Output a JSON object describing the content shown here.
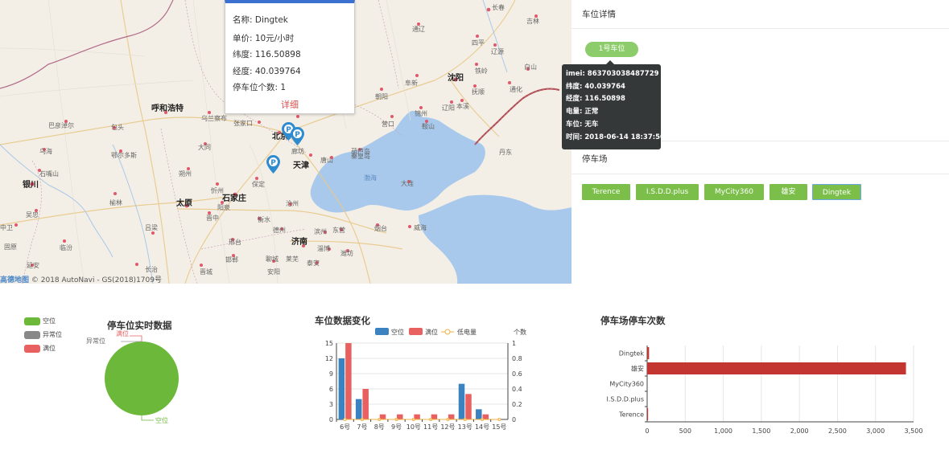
{
  "map": {
    "cities": [
      {
        "name": "长春",
        "big": false
      },
      {
        "name": "吉林",
        "big": false
      },
      {
        "name": "通辽",
        "big": false
      },
      {
        "name": "四平",
        "big": false
      },
      {
        "name": "辽源",
        "big": false
      },
      {
        "name": "铁岭",
        "big": false
      },
      {
        "name": "沈阳",
        "big": true
      },
      {
        "name": "白山",
        "big": false
      },
      {
        "name": "通化",
        "big": false
      },
      {
        "name": "抚顺",
        "big": false
      },
      {
        "name": "本溪",
        "big": false
      },
      {
        "name": "辽阳",
        "big": false
      },
      {
        "name": "阜新",
        "big": false
      },
      {
        "name": "朝阳",
        "big": false
      },
      {
        "name": "锦州",
        "big": false
      },
      {
        "name": "鞍山",
        "big": false
      },
      {
        "name": "营口",
        "big": false
      },
      {
        "name": "丹东",
        "big": false
      },
      {
        "name": "葫芦岛",
        "big": false
      },
      {
        "name": "秦皇岛",
        "big": false
      },
      {
        "name": "承德",
        "big": false
      },
      {
        "name": "呼和浩特",
        "big": true
      },
      {
        "name": "乌兰察布",
        "big": false
      },
      {
        "name": "张家口",
        "big": false
      },
      {
        "name": "包头",
        "big": false
      },
      {
        "name": "巴彦淖尔",
        "big": false
      },
      {
        "name": "大同",
        "big": false
      },
      {
        "name": "朔州",
        "big": false
      },
      {
        "name": "鄂尔多斯",
        "big": false
      },
      {
        "name": "乌海",
        "big": false
      },
      {
        "name": "石嘴山",
        "big": false
      },
      {
        "name": "银川",
        "big": true
      },
      {
        "name": "吴忠",
        "big": false
      },
      {
        "name": "忻州",
        "big": false
      },
      {
        "name": "榆林",
        "big": false
      },
      {
        "name": "太原",
        "big": true
      },
      {
        "name": "吕梁",
        "big": false
      },
      {
        "name": "晋中",
        "big": false
      },
      {
        "name": "阳泉",
        "big": false
      },
      {
        "name": "石家庄",
        "big": true
      },
      {
        "name": "北京",
        "big": true
      },
      {
        "name": "保定",
        "big": false
      },
      {
        "name": "廊坊",
        "big": false
      },
      {
        "name": "天津",
        "big": true
      },
      {
        "name": "唐山",
        "big": false
      },
      {
        "name": "沧州",
        "big": false
      },
      {
        "name": "衡水",
        "big": false
      },
      {
        "name": "德州",
        "big": false
      },
      {
        "name": "邢台",
        "big": false
      },
      {
        "name": "邯郸",
        "big": false
      },
      {
        "name": "聊城",
        "big": false
      },
      {
        "name": "济南",
        "big": true
      },
      {
        "name": "滨州",
        "big": false
      },
      {
        "name": "东营",
        "big": false
      },
      {
        "name": "淄博",
        "big": false
      },
      {
        "name": "潍坊",
        "big": false
      },
      {
        "name": "烟台",
        "big": false
      },
      {
        "name": "威海",
        "big": false
      },
      {
        "name": "大连",
        "big": false
      },
      {
        "name": "泰安",
        "big": false
      },
      {
        "name": "莱芜",
        "big": false
      },
      {
        "name": "长治",
        "big": false
      },
      {
        "name": "临汾",
        "big": false
      },
      {
        "name": "晋城",
        "big": false
      },
      {
        "name": "安阳",
        "big": false
      },
      {
        "name": "延安",
        "big": false
      },
      {
        "name": "中卫",
        "big": false
      },
      {
        "name": "固原",
        "big": false
      },
      {
        "name": "渤海",
        "big": false
      }
    ],
    "credit_logo": "高德地图",
    "credit_text": "© 2018 AutoNavi - GS(2018)1709号"
  },
  "infowindow": {
    "name": "名称: Dingtek",
    "price": "单价: 10元/小时",
    "lat": "纬度: 116.50898",
    "lng": "经度: 40.039764",
    "count": "停车位个数: 1",
    "detail": "详细"
  },
  "panel": {
    "spot_title": "车位详情",
    "spot_button": "1号车位",
    "tooltip": [
      "imei: 863703038487729",
      "纬度: 40.039764",
      "经度: 116.50898",
      "电量: 正常",
      "车位: 无车",
      "时间: 2018-06-14 18:37:50"
    ],
    "lot_title": "停车场",
    "lots": [
      "Terence",
      "I.S.D.D.plus",
      "MyCity360",
      "雄安",
      "Dingtek"
    ]
  },
  "charts": {
    "pie": {
      "title": "停车位实时数据",
      "legend": [
        {
          "name": "空位",
          "color": "#6cb83a"
        },
        {
          "name": "异常位",
          "color": "#888888"
        },
        {
          "name": "满位",
          "color": "#e8605f"
        }
      ],
      "labels": [
        "满位",
        "异常位",
        "空位"
      ]
    },
    "bar": {
      "title": "车位数据变化",
      "legend": [
        "空位",
        "满位",
        "低电量"
      ],
      "right_axis_name": "个数",
      "ticks_left": [
        "15",
        "12",
        "9",
        "6",
        "3",
        "0"
      ],
      "ticks_right": [
        "1",
        "0.8",
        "0.6",
        "0.4",
        "0.2",
        "0"
      ]
    },
    "hbar": {
      "title": "停车场停车次数",
      "ticks": [
        "0",
        "500",
        "1,000",
        "1,500",
        "2,000",
        "2,500",
        "3,000",
        "3,500"
      ]
    }
  },
  "chart_data": [
    {
      "type": "pie",
      "title": "停车位实时数据",
      "categories": [
        "空位",
        "异常位",
        "满位"
      ],
      "values": [
        1,
        0,
        0
      ],
      "colors": [
        "#6cb83a",
        "#888888",
        "#e8605f"
      ]
    },
    {
      "type": "bar",
      "title": "车位数据变化",
      "categories": [
        "6号",
        "7号",
        "8号",
        "9号",
        "10号",
        "11号",
        "12号",
        "13号",
        "14号",
        "15号"
      ],
      "series": [
        {
          "name": "空位",
          "color": "#3b82c0",
          "values": [
            12,
            4,
            0,
            0,
            0,
            0,
            0,
            7,
            2,
            0
          ]
        },
        {
          "name": "满位",
          "color": "#e8605f",
          "values": [
            15,
            6,
            1,
            1,
            1,
            1,
            1,
            5,
            1,
            0
          ]
        },
        {
          "name": "低电量",
          "color": "#f0b040",
          "values": [
            0,
            0,
            0,
            0,
            0,
            0,
            0,
            0,
            0,
            0
          ]
        }
      ],
      "ylim": [
        0,
        15
      ],
      "y2lim": [
        0,
        1
      ],
      "y2label": "个数",
      "legend": "top"
    },
    {
      "type": "bar",
      "orientation": "horizontal",
      "title": "停车场停车次数",
      "categories": [
        "Terence",
        "I.S.D.D.plus",
        "MyCity360",
        "雄安",
        "Dingtek"
      ],
      "values": [
        12,
        0,
        0,
        3400,
        25
      ],
      "color": "#c23531",
      "xlim": [
        0,
        3500
      ]
    }
  ]
}
